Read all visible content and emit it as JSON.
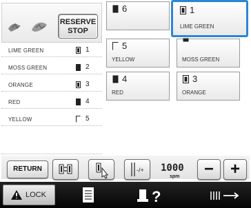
{
  "reserve_stop": {
    "label": "RESERVE\nSTOP"
  },
  "color_list": [
    {
      "name": "LIME GREEN",
      "number": "1",
      "spool": "filled-white"
    },
    {
      "name": "MOSS GREEN",
      "number": "2",
      "spool": "black"
    },
    {
      "name": "ORANGE",
      "number": "3",
      "spool": "filled-white"
    },
    {
      "name": "RED",
      "number": "4",
      "spool": "black"
    },
    {
      "name": "YELLOW",
      "number": "5",
      "spool": "outline"
    }
  ],
  "grid": [
    {
      "number": "6",
      "label": "",
      "highlighted": false
    },
    {
      "number": "1",
      "label": "LIME GREEN",
      "highlighted": true
    },
    {
      "number": "5",
      "label": "YELLOW",
      "highlighted": false
    },
    {
      "number": "",
      "label": "MOSS GREEN",
      "highlighted": false
    },
    {
      "number": "4",
      "label": "RED",
      "highlighted": false
    },
    {
      "number": "3",
      "label": "ORANGE",
      "highlighted": false
    }
  ],
  "toolbar": {
    "return_label": "RETURN",
    "speed_value": "1000",
    "speed_unit": "spm",
    "minus_label": "−",
    "plus_label": "+"
  },
  "bottombar": {
    "lock_label": "LOCK"
  },
  "colors": {
    "highlight": "#2a86d6",
    "bottombar": "#111111"
  }
}
